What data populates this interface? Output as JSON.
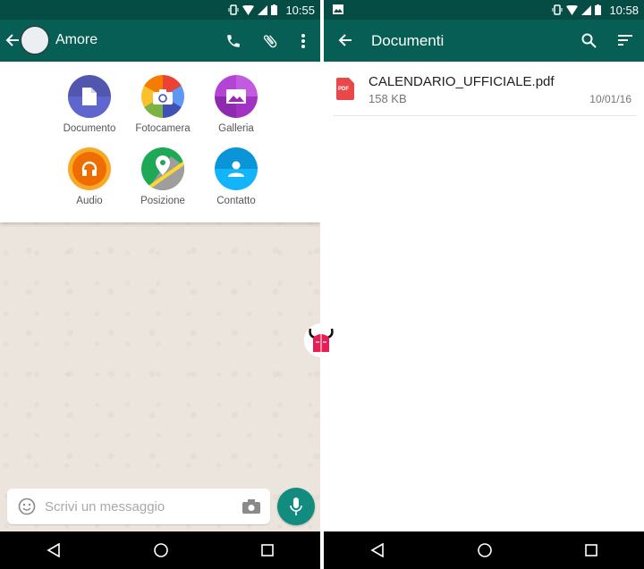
{
  "left_screen": {
    "status_bar": {
      "time": "10:55",
      "icons": [
        "vibrate-icon",
        "wifi-icon",
        "signal-icon",
        "battery-icon"
      ]
    },
    "app_bar": {
      "contact_name": "Amore",
      "actions": [
        "phone-icon",
        "paperclip-icon",
        "more-vert-icon"
      ]
    },
    "attach_menu": {
      "items": [
        {
          "label": "Documento",
          "icon": "document-icon",
          "color": "#5157ae"
        },
        {
          "label": "Fotocamera",
          "icon": "camera-icon",
          "color": "#ea4335"
        },
        {
          "label": "Galleria",
          "icon": "gallery-icon",
          "color": "#ac44cf"
        },
        {
          "label": "Audio",
          "icon": "headphones-icon",
          "color": "#f58e1d"
        },
        {
          "label": "Posizione",
          "icon": "location-icon",
          "color": "#1fa855"
        },
        {
          "label": "Contatto",
          "icon": "contact-icon",
          "color": "#0eabf4"
        }
      ]
    },
    "composer": {
      "placeholder": "Scrivi un messaggio"
    }
  },
  "right_screen": {
    "status_bar": {
      "time": "10:58",
      "icons": [
        "image-notification-icon",
        "vibrate-icon",
        "wifi-icon",
        "signal-icon",
        "battery-icon"
      ]
    },
    "app_bar": {
      "title": "Documenti",
      "actions": [
        "search-icon",
        "sort-icon"
      ]
    },
    "files": [
      {
        "name": "CALENDARIO_UFFICIALE.pdf",
        "size": "158 KB",
        "date": "10/01/16",
        "type_badge": "PDF"
      }
    ]
  },
  "colors": {
    "status_bar": "#054d44",
    "app_bar": "#075e54",
    "accent": "#128c7e",
    "pdf_red": "#e94848"
  }
}
